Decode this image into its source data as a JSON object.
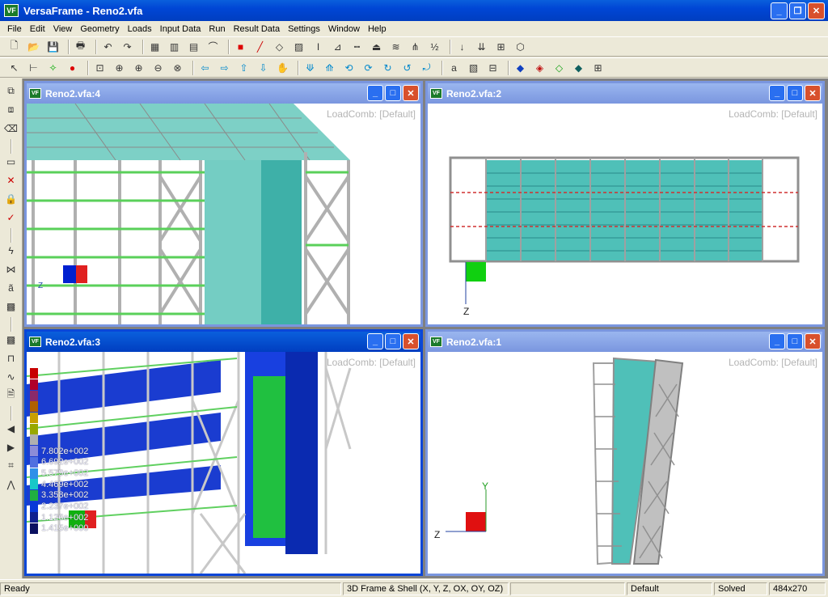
{
  "app": {
    "title": "VersaFrame - Reno2.vfa",
    "logo": "VF"
  },
  "menu": [
    "File",
    "Edit",
    "View",
    "Geometry",
    "Loads",
    "Input Data",
    "Run",
    "Result Data",
    "Settings",
    "Window",
    "Help"
  ],
  "toolbar1_icons": [
    "new-icon",
    "open-icon",
    "save-icon",
    "print-icon",
    "undo-icon",
    "redo-icon",
    "grid-icon",
    "frame-grid-icon",
    "shell-grid-icon",
    "arc-icon",
    "node-icon",
    "line-icon",
    "shell-icon",
    "area-icon",
    "section-icon",
    "member-release-icon",
    "divide-icon",
    "support-icon",
    "spring-icon",
    "node-renumber-icon",
    "member-renumber-icon",
    "point-load-icon",
    "distributed-load-icon",
    "area-load-icon",
    "wind-load-icon"
  ],
  "toolbar2_icons": [
    "select-icon",
    "dimension-icon",
    "snap-icon",
    "point-icon",
    "zoom-window-icon",
    "zoom-extents-icon",
    "zoom-in-icon",
    "zoom-out-icon",
    "zoom-previous-icon",
    "pan-left-icon",
    "pan-right-icon",
    "pan-up-icon",
    "pan-down-icon",
    "pan-hand-icon",
    "rotate-down-icon",
    "rotate-up-icon",
    "rotate-left-icon",
    "rotate-right-icon",
    "rotate-cw-icon",
    "rotate-ccw-icon",
    "rotate-free-icon",
    "label-icon",
    "hatch-icon",
    "member-display-icon",
    "view-3d-icon",
    "view-front-icon",
    "view-side-icon",
    "view-top-icon",
    "shrink-icon"
  ],
  "lefttb_icons": [
    "copy-icon",
    "move-icon",
    "erase-icon",
    "select-box-icon",
    "delete-icon",
    "lock-icon",
    "check-icon",
    "split-icon",
    "intersect-icon",
    "assign-icon",
    "contour-icon",
    "contour-alt-icon",
    "frame-icon",
    "deflection-icon",
    "report-icon",
    "back-icon",
    "forward-icon",
    "crop-icon",
    "animate-icon"
  ],
  "windows": [
    {
      "id": "w4",
      "title": "Reno2.vfa:4",
      "loadcomb": "LoadComb: [Default]"
    },
    {
      "id": "w2",
      "title": "Reno2.vfa:2",
      "loadcomb": "LoadComb: [Default]",
      "axis_label": "Z"
    },
    {
      "id": "w3",
      "title": "Reno2.vfa:3",
      "loadcomb": "LoadComb: [Default]"
    },
    {
      "id": "w1",
      "title": "Reno2.vfa:1",
      "loadcomb": "LoadComb: [Default]",
      "axis_y": "Y",
      "axis_z": "Z"
    }
  ],
  "legend": [
    {
      "color": "#c80000",
      "label": ""
    },
    {
      "color": "#b0002a",
      "label": ""
    },
    {
      "color": "#8a2a6a",
      "label": ""
    },
    {
      "color": "#b06000",
      "label": ""
    },
    {
      "color": "#c8a000",
      "label": ""
    },
    {
      "color": "#98a800",
      "label": ""
    },
    {
      "color": "#b0b0b0",
      "label": ""
    },
    {
      "color": "#8c8cd8",
      "label": "7.802e+002"
    },
    {
      "color": "#5070e0",
      "label": "6.692e+002"
    },
    {
      "color": "#2e90e8",
      "label": "5.579e+002"
    },
    {
      "color": "#18c8c8",
      "label": "4.469e+002"
    },
    {
      "color": "#20b040",
      "label": "3.358e+002"
    },
    {
      "color": "#0838d8",
      "label": "2.237e+002"
    },
    {
      "color": "#102090",
      "label": "1.126e+002"
    },
    {
      "color": "#0a1060",
      "label": "1.415e+000"
    }
  ],
  "status": {
    "ready": "Ready",
    "dof": "3D Frame & Shell (X, Y, Z, OX, OY, OZ)",
    "blank": "",
    "loadcomb": "Default",
    "state": "Solved",
    "size": "484x270"
  }
}
